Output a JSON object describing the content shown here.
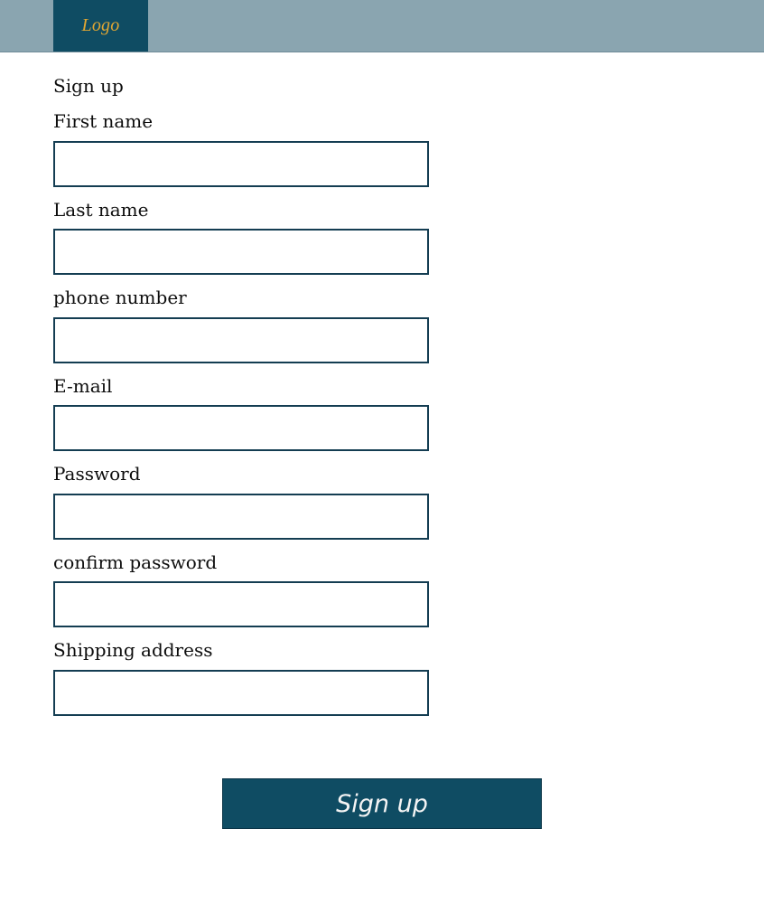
{
  "header": {
    "logo_text": "Logo"
  },
  "form": {
    "title": "Sign up",
    "fields": [
      {
        "label": "First name",
        "value": "",
        "placeholder": ""
      },
      {
        "label": "Last name",
        "value": "",
        "placeholder": ""
      },
      {
        "label": "phone number",
        "value": "",
        "placeholder": ""
      },
      {
        "label": "E-mail",
        "value": "",
        "placeholder": ""
      },
      {
        "label": "Password",
        "value": "",
        "placeholder": ""
      },
      {
        "label": "confirm password",
        "value": "",
        "placeholder": ""
      },
      {
        "label": "Shipping address",
        "value": "",
        "placeholder": ""
      }
    ],
    "submit_label": "Sign up"
  },
  "colors": {
    "header_bg": "#8aa5b0",
    "brand": "#0f4c63",
    "logo_text": "#e0a633",
    "input_border": "#143d52"
  }
}
